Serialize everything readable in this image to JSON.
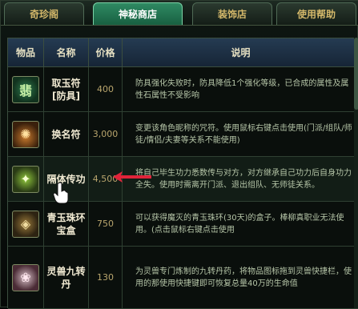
{
  "tabs": [
    {
      "label": "奇珍阁",
      "active": false
    },
    {
      "label": "神秘商店",
      "active": true
    },
    {
      "label": "装饰店",
      "active": false
    },
    {
      "label": "使用帮助",
      "active": false
    }
  ],
  "table": {
    "headers": {
      "icon": "物品",
      "name": "名称",
      "price": "价格",
      "desc": "说明"
    },
    "rows": [
      {
        "icon": "jade-talisman-icon",
        "icon_glyph": "翡",
        "name": "取玉符[防具]",
        "price": "400",
        "desc": "防具强化失败时，防具降低1个强化等级，已合成的属性及属性石属性不受影响"
      },
      {
        "icon": "fire-talisman-icon",
        "icon_glyph": "✺",
        "name": "换名符",
        "price": "3,000",
        "desc": "变更该角色昵称的咒符。使用鼠标右键点击使用(门派/组队/师徒/情侣/夫妻等关系不能使用)"
      },
      {
        "icon": "green-talisman-icon",
        "icon_glyph": "✦",
        "name": "隔体传功",
        "price": "4,500",
        "desc": "将自己毕生功力悉数传与对方，对方继承自己功力后自身功力全失。使用时需离开门派、退出组队、无师徒关系。"
      },
      {
        "icon": "jade-box-icon",
        "icon_glyph": "◈",
        "name": "青玉珠环宝盒",
        "price": "750",
        "desc": "可以获得魔灭的青玉珠环(30天)的盒子。棒柳真职业无法使用。(点击鼠标右键点击使用"
      },
      {
        "icon": "pill-icon",
        "icon_glyph": "❀",
        "name": "灵兽九转丹",
        "price": "130",
        "desc": "为灵兽专门炼制的九转丹药，将物品图标拖到灵兽快捷栏，使用的那使用快捷键即可恢复总量40万的生命值"
      }
    ]
  },
  "colors": {
    "active_tab": "#2f8a63",
    "header_bg": "#253b52",
    "gold_text": "#d4b86a",
    "desc_text": "#b6c6a8",
    "arrow": "#e0243a"
  }
}
